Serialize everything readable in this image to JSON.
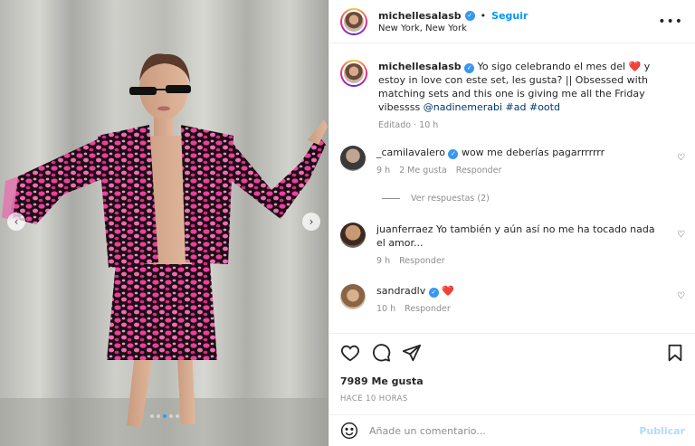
{
  "post": {
    "username": "michellesalasb",
    "follow_label": "Seguir",
    "separator": "•",
    "location": "New York, New York",
    "more_icon": "more-horizontal-icon",
    "verified_glyph": "✓"
  },
  "caption": {
    "username": "michellesalasb",
    "text_part1": "Yo sigo celebrando el mes del",
    "heart_emoji": "❤️",
    "text_part2": "y estoy in love con este set, les gusta? || Obsessed with matching sets and this one is giving me all the Friday vibessss",
    "mention": "@nadinemerabi",
    "hashtag_ad": "#ad",
    "hashtag_ootd": "#ootd",
    "edited": "Editado",
    "dot": "·",
    "time": "10 h"
  },
  "comments": [
    {
      "username": "_camilavalero",
      "verified": true,
      "text": "wow me deberías pagarrrrrrr",
      "time": "9 h",
      "likes": "2 Me gusta",
      "reply_label": "Responder"
    },
    {
      "username": "juanferraez",
      "verified": false,
      "text": "Yo también y aún así no me ha tocado nada el amor...",
      "time": "9 h",
      "likes": "",
      "reply_label": "Responder"
    },
    {
      "username": "sandradlv",
      "verified": true,
      "text": "❤️",
      "time": "10 h",
      "likes": "",
      "reply_label": "Responder"
    }
  ],
  "view_replies": "Ver respuestas (2)",
  "actions": {
    "likes": "7989 Me gusta",
    "posted_ago": "HACE 10 HORAS"
  },
  "add_comment": {
    "placeholder": "Añade un comentario...",
    "publish_label": "Publicar"
  },
  "carousel": {
    "prev_glyph": "‹",
    "next_glyph": "›",
    "slide_count": 5,
    "active_slide": 3
  },
  "colors": {
    "accent": "#0095f6",
    "verified": "#3897f0",
    "publish_disabled": "#b3dbff",
    "outfit_pink": "#e83d9a"
  }
}
